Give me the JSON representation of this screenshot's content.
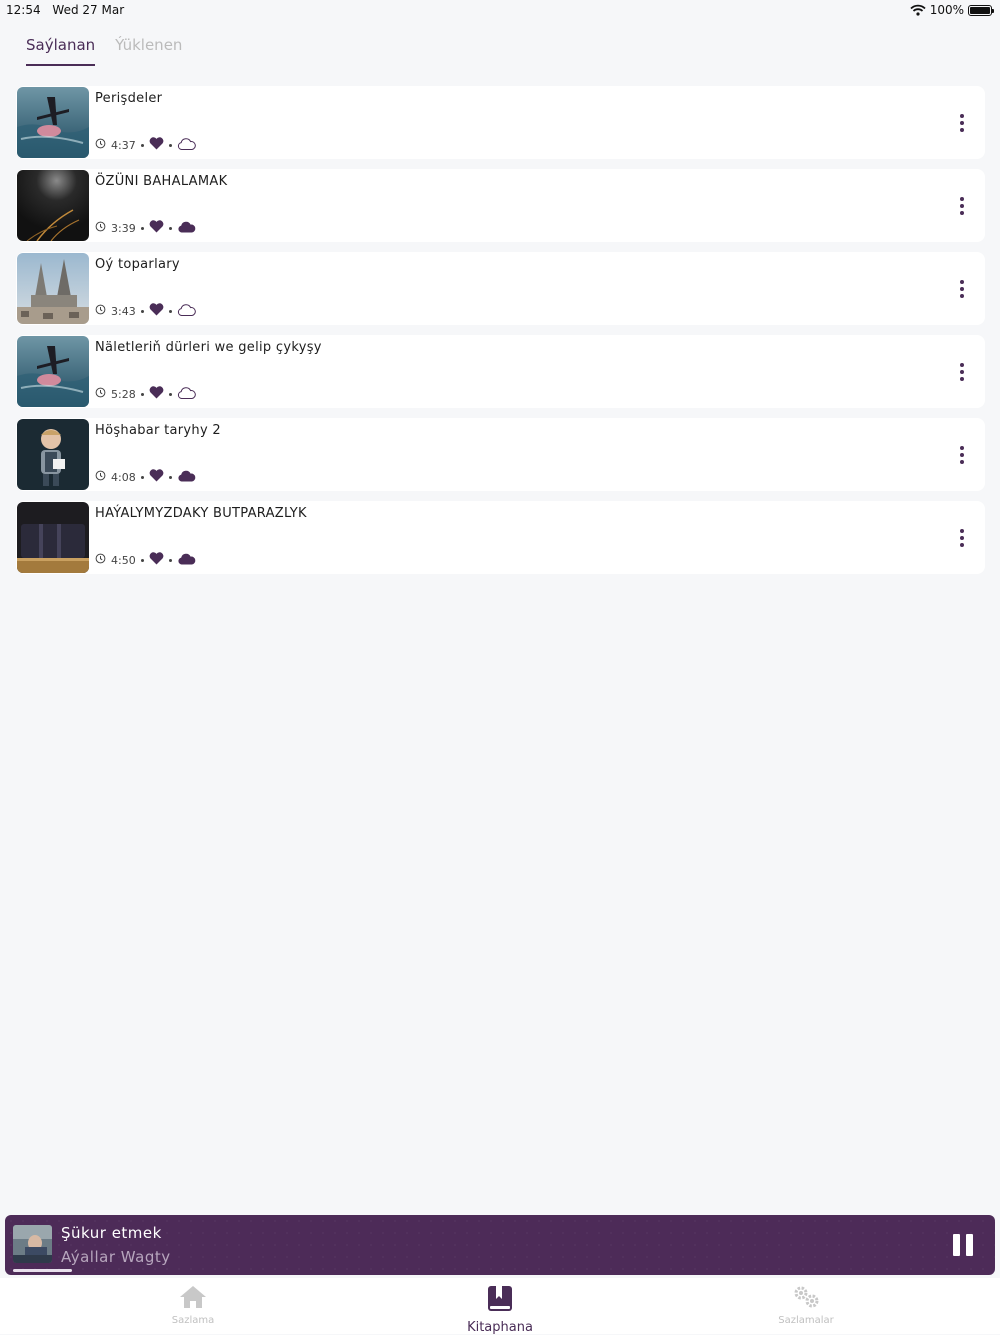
{
  "status_bar": {
    "time": "12:54",
    "date": "Wed 27 Mar",
    "battery": "100%"
  },
  "tabs": [
    {
      "label": "Saýlanan",
      "active": true
    },
    {
      "label": "Ýüklenen",
      "active": false
    }
  ],
  "items": [
    {
      "title": "Perişdeler",
      "duration": "4:37",
      "favorited": true,
      "downloaded": false,
      "thumb": "swimmer"
    },
    {
      "title": "ÖZÜNI BAHALAMAK",
      "duration": "3:39",
      "favorited": true,
      "downloaded": true,
      "thumb": "dark-light"
    },
    {
      "title": "Oý toparlary",
      "duration": "3:43",
      "favorited": true,
      "downloaded": false,
      "thumb": "cathedral"
    },
    {
      "title": "Näletleriň dürleri we gelip çykyşy",
      "duration": "5:28",
      "favorited": true,
      "downloaded": false,
      "thumb": "swimmer"
    },
    {
      "title": "Höşhabar taryhy 2",
      "duration": "4:08",
      "favorited": true,
      "downloaded": true,
      "thumb": "child"
    },
    {
      "title": "HAÝALYMYZDAKY BUTPARAZLYK",
      "duration": "4:50",
      "favorited": true,
      "downloaded": true,
      "thumb": "book"
    }
  ],
  "player": {
    "title": "Şükur etmek",
    "subtitle": "Aýallar Wagty",
    "progress": 0.06
  },
  "nav": [
    {
      "label": "Sazlama",
      "icon": "home-icon",
      "active": false
    },
    {
      "label": "Kitaphana",
      "icon": "library-book-icon",
      "active": true
    },
    {
      "label": "Sazlamalar",
      "icon": "gears-icon",
      "active": false
    }
  ],
  "colors": {
    "accent": "#4a2d57",
    "player_bg": "#4d2b58",
    "page_bg": "#f6f7f9"
  }
}
